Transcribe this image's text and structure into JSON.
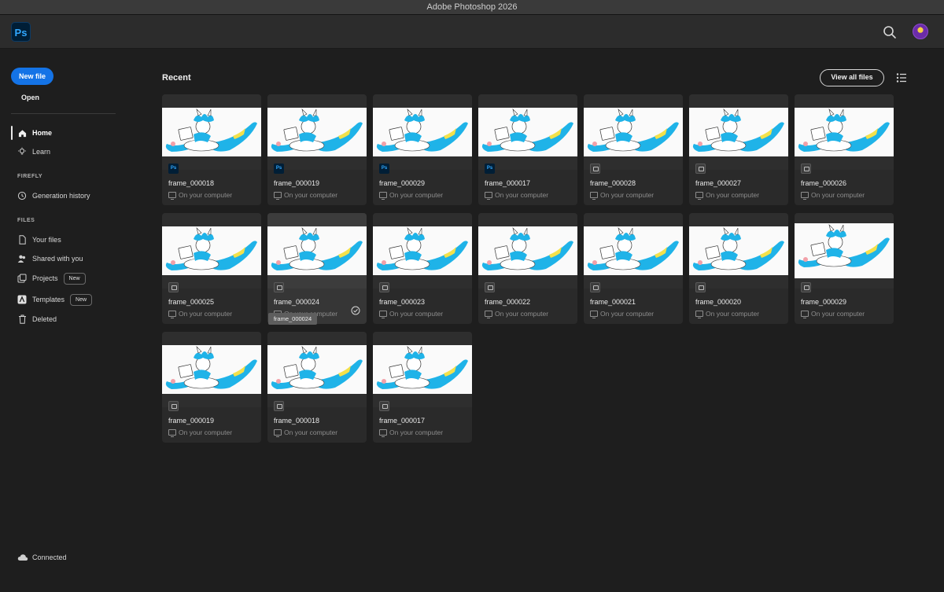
{
  "window": {
    "title": "Adobe Photoshop 2026"
  },
  "app": {
    "logo_text": "Ps"
  },
  "sidebar": {
    "new_file_label": "New file",
    "open_label": "Open",
    "home_label": "Home",
    "learn_label": "Learn",
    "firefly_section": "FIREFLY",
    "generation_history_label": "Generation history",
    "files_section": "FILES",
    "your_files_label": "Your files",
    "shared_label": "Shared with you",
    "projects_label": "Projects",
    "templates_label": "Templates",
    "new_badge": "New",
    "deleted_label": "Deleted",
    "connected_label": "Connected"
  },
  "main": {
    "recent_title": "Recent",
    "view_all_label": "View all files",
    "location_label": "On your computer",
    "tooltip_text": "frame_000024",
    "files": [
      {
        "name": "frame_000018",
        "type": "ps",
        "type_label": "Ps"
      },
      {
        "name": "frame_000019",
        "type": "ps",
        "type_label": "Ps"
      },
      {
        "name": "frame_000029",
        "type": "ps",
        "type_label": "Ps"
      },
      {
        "name": "frame_000017",
        "type": "ps",
        "type_label": "Ps"
      },
      {
        "name": "frame_000028",
        "type": "img",
        "type_label": ""
      },
      {
        "name": "frame_000027",
        "type": "img",
        "type_label": ""
      },
      {
        "name": "frame_000026",
        "type": "img",
        "type_label": ""
      },
      {
        "name": "frame_000025",
        "type": "img",
        "type_label": ""
      },
      {
        "name": "frame_000024",
        "type": "img",
        "type_label": "",
        "selected": true
      },
      {
        "name": "frame_000023",
        "type": "img",
        "type_label": ""
      },
      {
        "name": "frame_000022",
        "type": "img",
        "type_label": ""
      },
      {
        "name": "frame_000021",
        "type": "img",
        "type_label": ""
      },
      {
        "name": "frame_000020",
        "type": "img",
        "type_label": ""
      },
      {
        "name": "frame_000029",
        "type": "img",
        "type_label": "",
        "tall": true
      },
      {
        "name": "frame_000019",
        "type": "img",
        "type_label": ""
      },
      {
        "name": "frame_000018",
        "type": "img",
        "type_label": ""
      },
      {
        "name": "frame_000017",
        "type": "img",
        "type_label": ""
      }
    ]
  },
  "colors": {
    "accent": "#1473e6",
    "ps_brand": "#31a8ff",
    "background": "#1e1e1e"
  }
}
